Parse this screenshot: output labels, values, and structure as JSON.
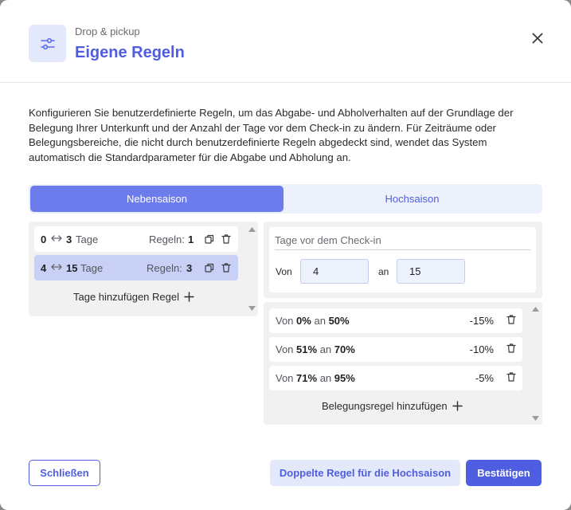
{
  "header": {
    "eyebrow": "Drop & pickup",
    "title": "Eigene Regeln",
    "icon": "sliders-icon",
    "close_icon": "close-icon"
  },
  "description": "Konfigurieren Sie benutzerdefinierte Regeln, um das Abgabe- und Abholverhalten auf der Grundlage der Belegung Ihrer Unterkunft und der Anzahl der Tage vor dem Check-in zu ändern. Für Zeiträume oder Belegungsbereiche, die nicht durch benutzerdefinierte Regeln abgedeckt sind, wendet das System automatisch die Standardparameter für die Abgabe und Abholung an.",
  "tabs": [
    {
      "label": "Nebensaison",
      "active": true
    },
    {
      "label": "Hochsaison",
      "active": false
    }
  ],
  "day_ranges": [
    {
      "from": "0",
      "to": "3",
      "unit": "Tage",
      "rules_label": "Regeln:",
      "rules_count": "1",
      "selected": false
    },
    {
      "from": "4",
      "to": "15",
      "unit": "Tage",
      "rules_label": "Regeln:",
      "rules_count": "3",
      "selected": true
    }
  ],
  "add_day_rule_label": "Tage hinzufügen Regel",
  "days_before_checkin": {
    "label": "Tage vor dem Check-in",
    "from_label": "Von",
    "from_value": "4",
    "to_label": "an",
    "to_value": "15"
  },
  "occupancy_rules": [
    {
      "prefix": "Von",
      "from": "0%",
      "mid": "an",
      "to": "50%",
      "adjustment": "-15%"
    },
    {
      "prefix": "Von",
      "from": "51%",
      "mid": "an",
      "to": "70%",
      "adjustment": "-10%"
    },
    {
      "prefix": "Von",
      "from": "71%",
      "mid": "an",
      "to": "95%",
      "adjustment": "-5%"
    }
  ],
  "add_occupancy_rule_label": "Belegungsregel hinzufügen",
  "footer": {
    "close_label": "Schließen",
    "duplicate_label": "Doppelte Regel für die Hochsaison",
    "confirm_label": "Bestätigen"
  },
  "colors": {
    "accent": "#4f5ee0",
    "tab_active": "#6d7cec",
    "selected_row": "#c8d0f6"
  }
}
